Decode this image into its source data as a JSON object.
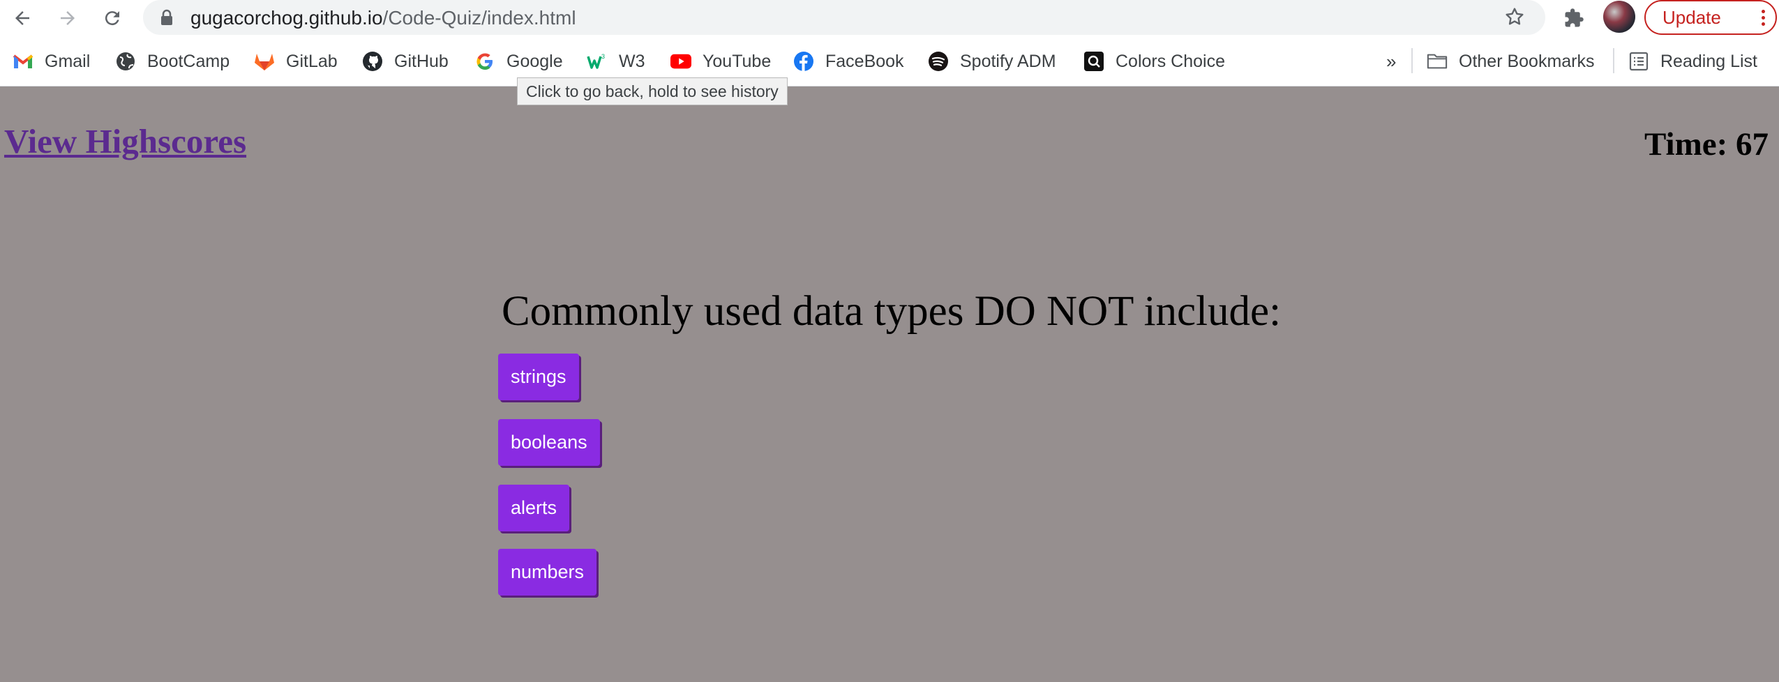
{
  "browser": {
    "url_host": "gugacorchog.github.io",
    "url_path": "/Code-Quiz/index.html",
    "update_label": "Update",
    "tooltip": "Click to go back, hold to see history",
    "overflow_label": "»",
    "icons": [
      "back-arrow-icon",
      "forward-arrow-icon",
      "reload-icon",
      "lock-icon",
      "star-icon",
      "extensions-icon",
      "profile-avatar",
      "menu-dots-icon"
    ]
  },
  "bookmarks": {
    "items": [
      "Gmail",
      "BootCamp",
      "GitLab",
      "GitHub",
      "Google",
      "W3",
      "YouTube",
      "FaceBook",
      "Spotify ADM",
      "Colors Choice"
    ],
    "other_bookmarks": "Other Bookmarks",
    "reading_list": "Reading List"
  },
  "quiz": {
    "highscores_link": "View Highscores",
    "timer": "Time: 67",
    "question": "Commonly used data types DO NOT include:",
    "answers": [
      "strings",
      "booleans",
      "alerts",
      "numbers"
    ]
  },
  "colors": {
    "page_background": "#968f8f",
    "answer_button": "#8a2be2",
    "link": "#5b2a8f",
    "update_red": "#c5221f"
  }
}
